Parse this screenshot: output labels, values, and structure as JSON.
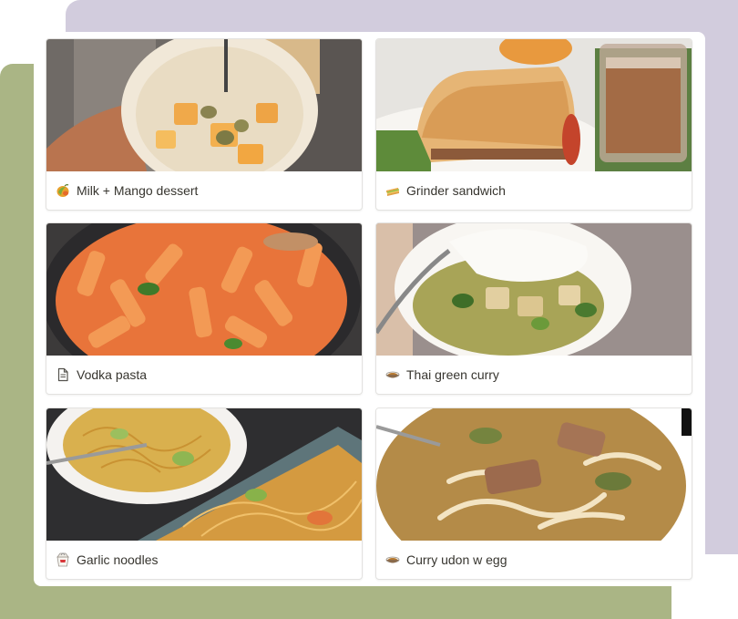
{
  "gallery": {
    "cards": [
      {
        "title": "Milk + Mango dessert",
        "icon": "mango-icon"
      },
      {
        "title": "Grinder sandwich",
        "icon": "sandwich-icon"
      },
      {
        "title": "Vodka pasta",
        "icon": "page-icon"
      },
      {
        "title": "Thai green curry",
        "icon": "curry-bowl-icon"
      },
      {
        "title": "Garlic noodles",
        "icon": "takeout-box-icon"
      },
      {
        "title": "Curry udon w egg",
        "icon": "curry-bowl-icon"
      }
    ]
  },
  "colors": {
    "lavender_backdrop": "#d2ccdd",
    "olive_backdrop": "#aab585",
    "text": "#37352f",
    "card_border": "#e3e2e0"
  }
}
